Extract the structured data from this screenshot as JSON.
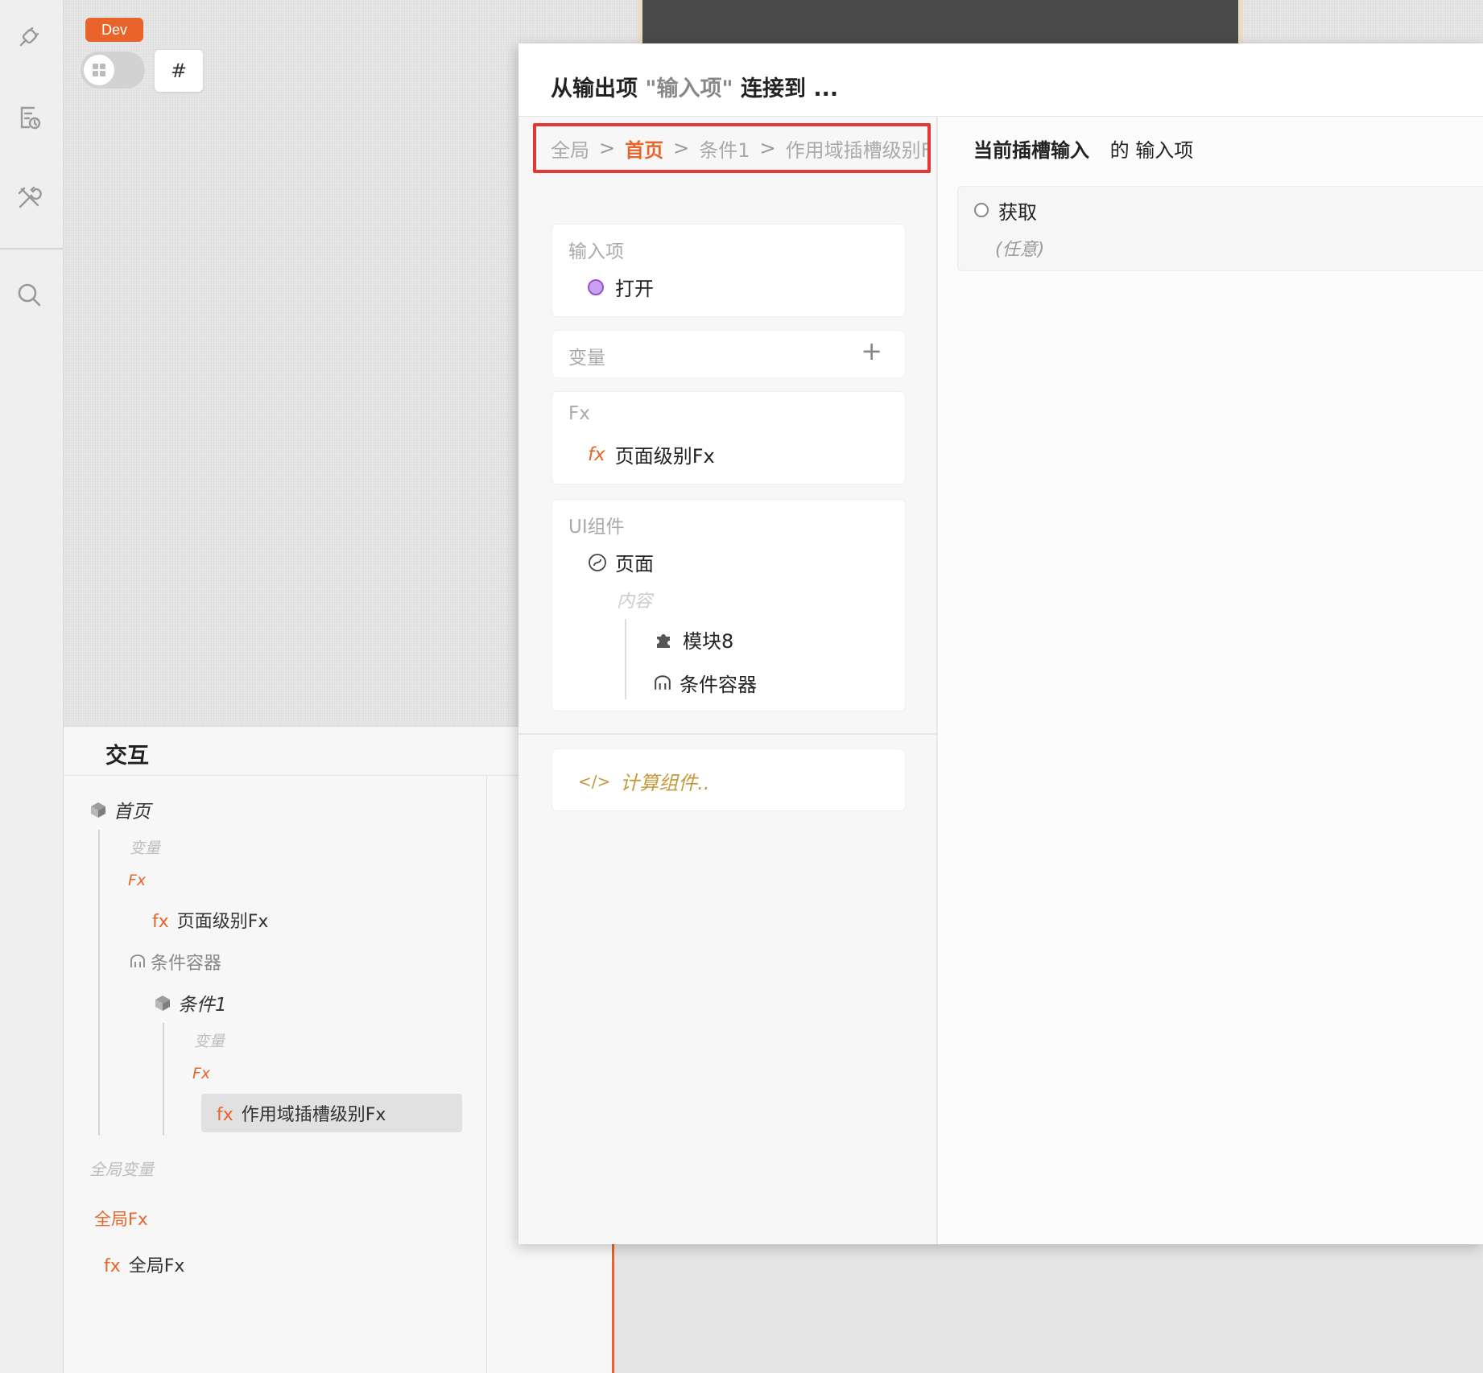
{
  "canvas": {
    "env_badge": "Dev",
    "hash_button": "#"
  },
  "interaction_panel": {
    "title": "交互",
    "tree": {
      "root": "首页",
      "root_vars": "变量",
      "root_fx_heading": "Fx",
      "root_fx_prefix": "fx",
      "root_fx_item": "页面级别Fx",
      "container": "条件容器",
      "cond": "条件1",
      "cond_vars": "变量",
      "cond_fx_heading": "Fx",
      "cond_fx_prefix": "fx",
      "cond_fx_item": "作用域插槽级别Fx",
      "global_vars": "全局变量",
      "global_fx_heading": "全局Fx",
      "global_fx_prefix": "fx",
      "global_fx_item": "全局Fx"
    }
  },
  "modal": {
    "title_prefix": "从输出项",
    "title_quoted": "\"输入项\"",
    "title_suffix": "连接到 ...",
    "breadcrumb": {
      "items": [
        "全局",
        "首页",
        "条件1",
        "作用域插槽级别Fx"
      ],
      "separator": ">"
    },
    "inputs_card": {
      "heading": "输入项",
      "item": "打开"
    },
    "vars_card": {
      "heading": "变量",
      "add": "+"
    },
    "fx_card": {
      "heading": "Fx",
      "prefix": "fx",
      "item": "页面级别Fx"
    },
    "ui_card": {
      "heading": "UI组件",
      "page": "页面",
      "slot": "内容",
      "module": "模块8",
      "container": "条件容器"
    },
    "compute": {
      "icon": "</>",
      "label": "计算组件.."
    },
    "right": {
      "head_bold": "当前插槽输入",
      "head_rest": "的 输入项",
      "port_label": "获取",
      "port_type": "(任意)"
    }
  },
  "colors": {
    "accent": "#e8642a",
    "highlight_border": "#e53935",
    "port_purple": "#9a4fd6",
    "compute_gold": "#c59a3c"
  }
}
